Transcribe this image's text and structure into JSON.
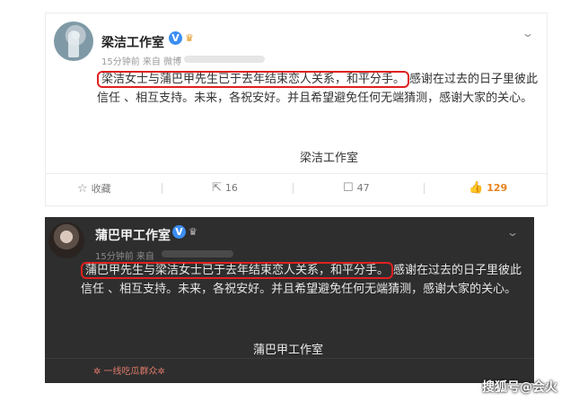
{
  "post1": {
    "account_name": "梁洁工作室",
    "meta": "15分钟前 来自 微博",
    "text_highlight": "梁洁女士与蒲巴甲先生已于去年结束恋人关系，和平分手。",
    "text_rest": "感谢在过去的日子里彼此信任 、相互支持。未来，各祝安好。并且希望避免任何无端猜测，感谢大家的关心。",
    "signature": "梁洁工作室",
    "actions": {
      "favorite_label": "收藏",
      "share_count": "16",
      "comment_count": "47",
      "like_count": "129"
    }
  },
  "post2": {
    "account_name": "蒲巴甲工作室",
    "meta": "15分钟前 来自",
    "text_highlight": "蒲巴甲先生与梁洁女士已于去年结束恋人关系，和平分手。",
    "text_rest": "感谢在过去的日子里彼此信任 、相互支持。未来，各祝安好。并且希望避免任何无端猜测，感谢大家的关心。",
    "signature": "蒲巴甲工作室",
    "watermark_left": "✲ 一线吃瓜群众✲",
    "watermark_right": "搜狐号@会火"
  },
  "icons": {
    "verified": "V",
    "crown": "♛",
    "chevron": "⌄",
    "favorite": "☆",
    "share": "⇱",
    "comment": "☐",
    "like": "👍"
  },
  "colors": {
    "highlight_border": "#e02020",
    "verified_blue": "#3b8ef3",
    "like_orange": "#e8821d",
    "dark_card": "#2e2e2e"
  }
}
